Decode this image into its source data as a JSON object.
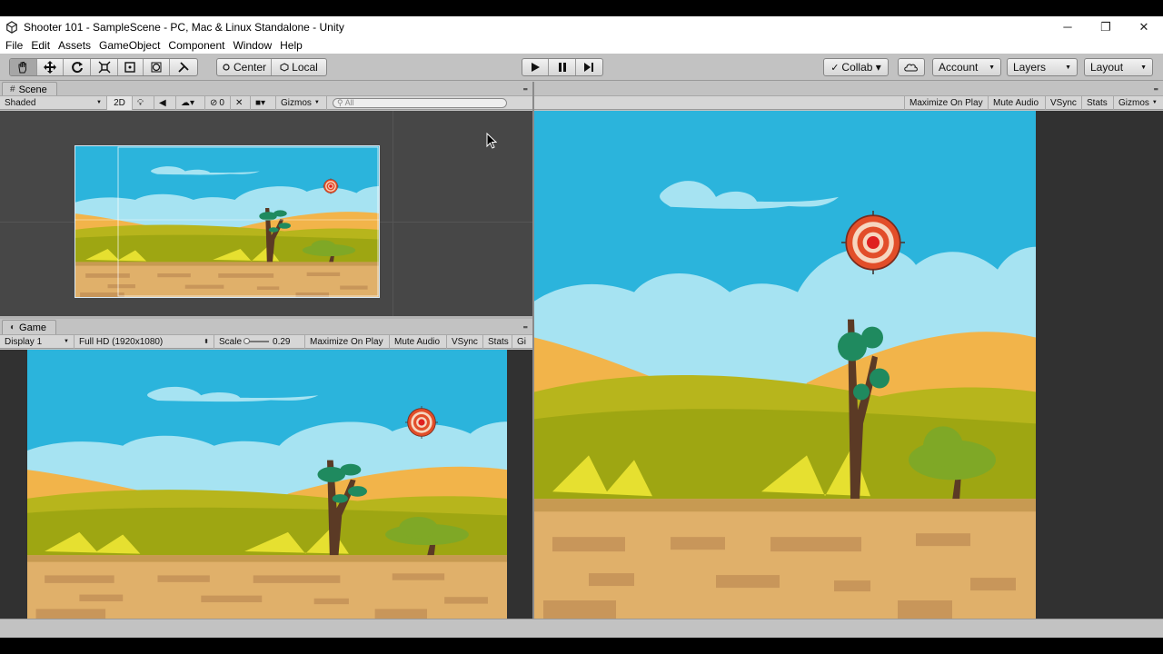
{
  "window": {
    "title": "Shooter 101 - SampleScene - PC, Mac & Linux Standalone - Unity",
    "controls": {
      "minimize": "─",
      "restore": "❐",
      "close": "✕"
    }
  },
  "menu": [
    "File",
    "Edit",
    "Assets",
    "GameObject",
    "Component",
    "Window",
    "Help"
  ],
  "toolbar": {
    "tools": [
      "hand-tool",
      "move-tool",
      "rotate-tool",
      "scale-tool",
      "rect-tool",
      "transform-tool",
      "custom-tool"
    ],
    "pivot": "Center",
    "space": "Local",
    "collab": "Collab ▾",
    "account": "Account",
    "layers": "Layers",
    "layout": "Layout"
  },
  "scene": {
    "tab": "Scene",
    "shading": "Shaded",
    "mode2d": "2D",
    "fx_count": "0",
    "gizmos": "Gizmos",
    "search_placeholder": "All"
  },
  "game": {
    "tab": "Game",
    "display": "Display 1",
    "resolution": "Full HD (1920x1080)",
    "scale_label": "Scale",
    "scale_value": "0.29",
    "scale_fraction": 0.05,
    "maximize": "Maximize On Play",
    "mute": "Mute Audio",
    "vsync": "VSync",
    "stats": "Stats",
    "gizmos": "Gi"
  },
  "game2": {
    "maximize": "Maximize On Play",
    "mute": "Mute Audio",
    "vsync": "VSync",
    "stats": "Stats",
    "gizmos": "Gizmos"
  },
  "colors": {
    "sky": "#2bb4dc",
    "cloud": "#a8e4f3",
    "sand": "#f2b44a",
    "grass": "#b9b81b",
    "ground": "#d9a65e"
  }
}
